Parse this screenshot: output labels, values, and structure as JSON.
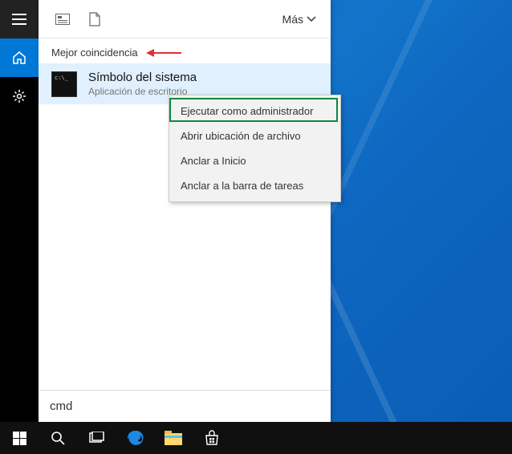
{
  "header": {
    "more_label": "Más"
  },
  "section": {
    "best_match": "Mejor coincidencia"
  },
  "result": {
    "title": "Símbolo del sistema",
    "subtitle": "Aplicación de escritorio"
  },
  "context_menu": {
    "items": [
      "Ejecutar como administrador",
      "Abrir ubicación de archivo",
      "Anclar a Inicio",
      "Anclar a la barra de tareas"
    ]
  },
  "search": {
    "value": "cmd"
  }
}
